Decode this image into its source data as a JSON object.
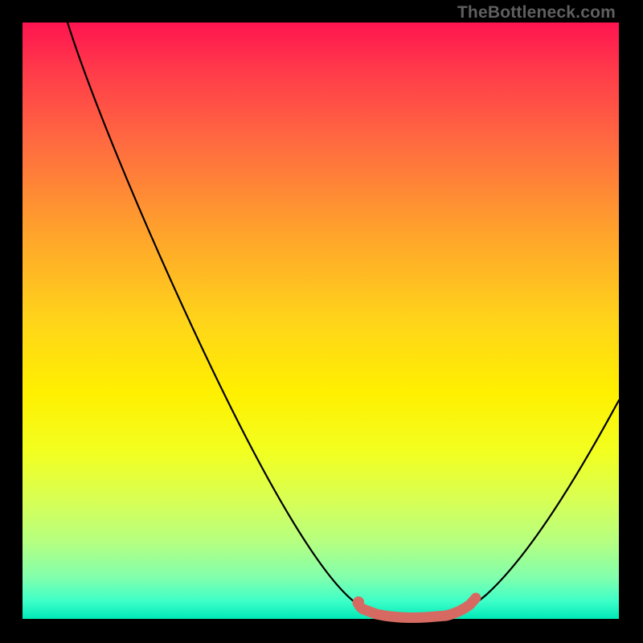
{
  "attribution": "TheBottleneck.com",
  "colors": {
    "page_bg": "#000000",
    "gradient_top": "#ff1450",
    "gradient_bottom": "#00e8b8",
    "curve": "#000000",
    "marker": "#d66a62"
  },
  "chart_data": {
    "type": "line",
    "title": "",
    "xlabel": "",
    "ylabel": "",
    "xlim": [
      0,
      100
    ],
    "ylim": [
      0,
      100
    ],
    "series": [
      {
        "name": "bottleneck-curve",
        "x": [
          0,
          6,
          12,
          18,
          24,
          30,
          36,
          42,
          48,
          54,
          58,
          62,
          66,
          70,
          76,
          82,
          88,
          94,
          100
        ],
        "y": [
          100,
          88,
          76,
          64,
          52,
          41,
          31,
          22,
          14,
          7,
          3,
          1,
          0,
          0,
          2,
          7,
          14,
          24,
          36
        ]
      }
    ],
    "markers": [
      {
        "name": "flat-start",
        "x": 58,
        "y": 2
      },
      {
        "name": "flat-end",
        "x": 72,
        "y": 2
      }
    ],
    "annotations": []
  }
}
